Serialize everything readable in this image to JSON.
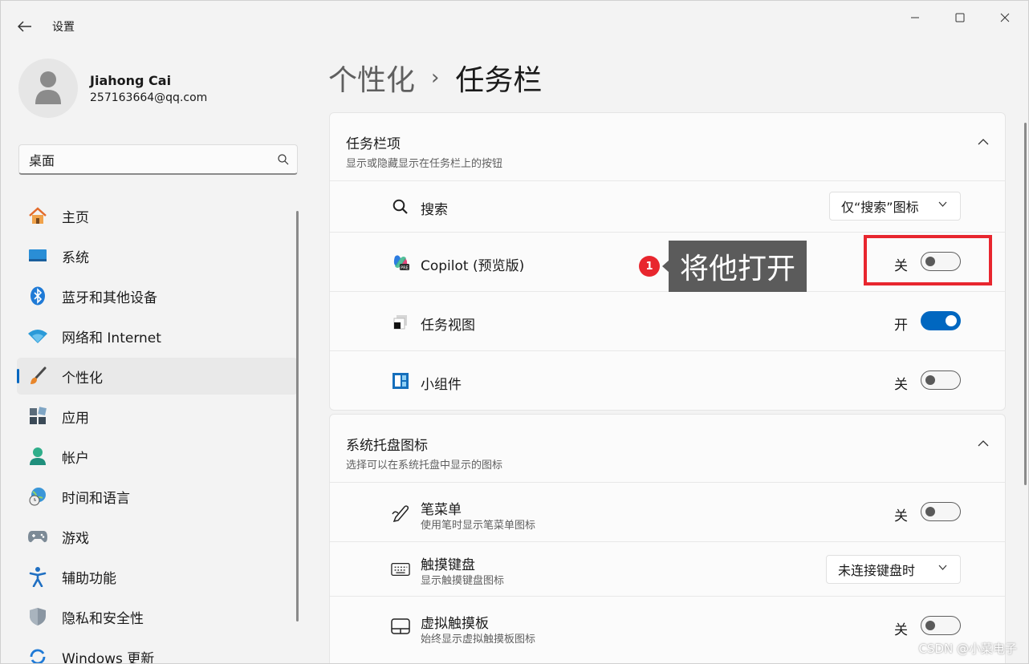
{
  "window": {
    "title": "设置"
  },
  "profile": {
    "name": "Jiahong Cai",
    "email": "257163664@qq.com"
  },
  "search": {
    "value": "桌面"
  },
  "sidebar": {
    "items": [
      {
        "label": "主页"
      },
      {
        "label": "系统"
      },
      {
        "label": "蓝牙和其他设备"
      },
      {
        "label": "网络和 Internet"
      },
      {
        "label": "个性化",
        "active": true
      },
      {
        "label": "应用"
      },
      {
        "label": "帐户"
      },
      {
        "label": "时间和语言"
      },
      {
        "label": "游戏"
      },
      {
        "label": "辅助功能"
      },
      {
        "label": "隐私和安全性"
      },
      {
        "label": "Windows 更新"
      }
    ]
  },
  "breadcrumb": {
    "parent": "个性化",
    "separator": "›",
    "current": "任务栏"
  },
  "taskbar_items": {
    "title": "任务栏项",
    "subtitle": "显示或隐藏显示在任务栏上的按钮",
    "rows": [
      {
        "label": "搜索",
        "dropdown": "仅“搜索”图标"
      },
      {
        "label": "Copilot (预览版)",
        "state": "关",
        "on": false
      },
      {
        "label": "任务视图",
        "state": "开",
        "on": true
      },
      {
        "label": "小组件",
        "state": "关",
        "on": false
      }
    ]
  },
  "tray_icons": {
    "title": "系统托盘图标",
    "subtitle": "选择可以在系统托盘中显示的图标",
    "rows": [
      {
        "label": "笔菜单",
        "sub": "使用笔时显示笔菜单图标",
        "state": "关",
        "on": false
      },
      {
        "label": "触摸键盘",
        "sub": "显示触摸键盘图标",
        "dropdown": "未连接键盘时"
      },
      {
        "label": "虚拟触摸板",
        "sub": "始终显示虚拟触摸板图标",
        "state": "关",
        "on": false
      }
    ]
  },
  "annotation": {
    "badge": "1",
    "text": "将他打开"
  },
  "watermark": "CSDN @小菜电子",
  "colors": {
    "accent": "#0067c0",
    "annotation_red": "#e8262e",
    "annotation_label_bg": "#5b5b5b"
  }
}
